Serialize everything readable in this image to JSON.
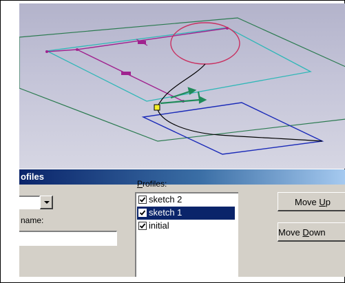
{
  "dialog": {
    "title": "ofiles",
    "profiles_label": "Profiles:",
    "name_label": "name:",
    "name_value": "",
    "combo_value": "",
    "profiles": [
      {
        "label": "sketch 2",
        "checked": true,
        "selected": false
      },
      {
        "label": "sketch 1",
        "checked": true,
        "selected": true
      },
      {
        "label": "initial",
        "checked": true,
        "selected": false
      }
    ],
    "move_up_label": "Move Up",
    "move_down_label": "Move Down"
  },
  "colors": {
    "title_bar_start": "#0a246a",
    "title_bar_end": "#a6caf0",
    "selection": "#0a246a",
    "dialog_face": "#d4d0c8",
    "plane_green": "#2a7a4f",
    "profile_cyan": "#2fb7b7",
    "sketch_magenta": "#a0238f",
    "lower_profile_blue": "#1a2ab8",
    "circle_red": "#c83060"
  },
  "viewport": {
    "description_icons": [
      "sketch-plane",
      "profile-rectangle",
      "loft-curve",
      "control-point",
      "axis-arrow"
    ]
  }
}
